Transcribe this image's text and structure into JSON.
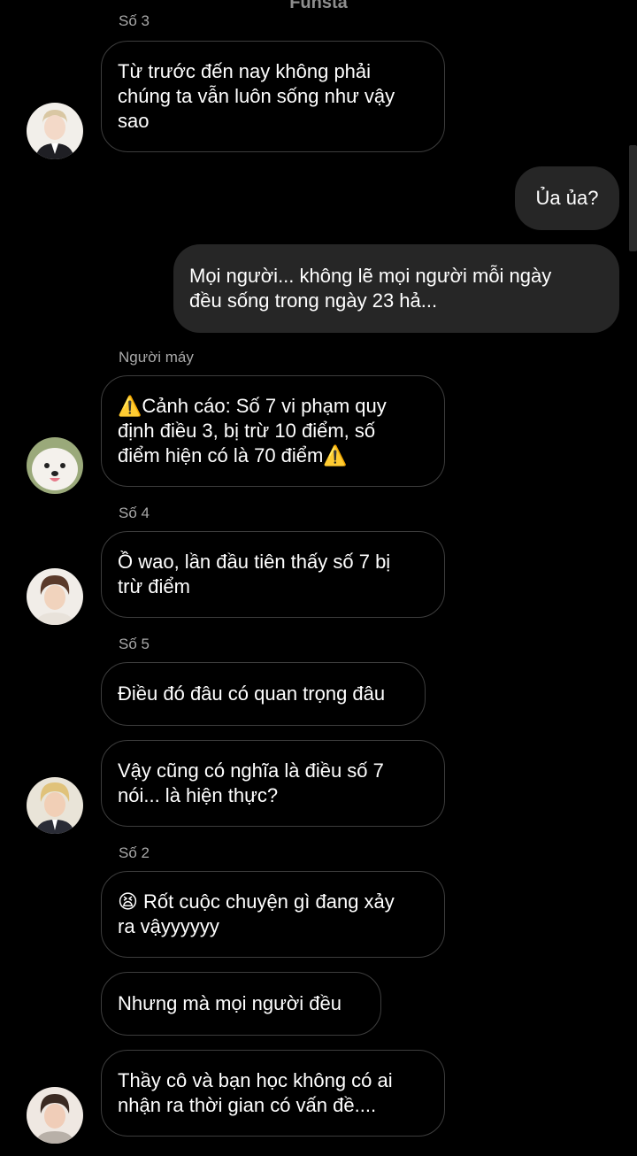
{
  "header": {
    "title": "Funsta"
  },
  "messages": {
    "m1_sender": "Số 3",
    "m1_line1": "Từ trước đến nay không phải",
    "m1_line2": "chúng ta vẫn luôn sống như vậy",
    "m1_line3": "sao",
    "m2_text": "Ủa ủa?",
    "m3_line1": "Mọi người... không lẽ mọi người mỗi ngày",
    "m3_line2": "đều sống trong ngày 23 hả...",
    "m4_sender": "Người máy",
    "m4_line1": "⚠️Cảnh cáo: Số 7 vi phạm quy",
    "m4_line2": "định điều 3, bị trừ 10 điểm, số",
    "m4_line3": "điểm hiện có là 70 điểm⚠️",
    "m5_sender": "Số 4",
    "m5_line1": "Ồ wao, lần đầu tiên thấy số 7 bị",
    "m5_line2": "trừ điểm",
    "m6_sender": "Số 5",
    "m6_text": "Điều đó đâu có quan trọng đâu",
    "m7_line1": "Vậy cũng có nghĩa là điều số 7",
    "m7_line2": "nói... là hiện thực?",
    "m8_sender": "Số 2",
    "m8_line1": "😫 Rốt cuộc chuyện gì đang xảy",
    "m8_line2": "ra vậyyyyyy",
    "m9_text": "Nhưng mà mọi người đều",
    "m10_line1": "Thầy cô và bạn học không có ai",
    "m10_line2": "nhận ra thời gian có vấn đề...."
  },
  "colors": {
    "background": "#000000",
    "incoming_border": "#3d3d3d",
    "outgoing_bg": "#262626",
    "sender_name": "#a8a8a8"
  },
  "icons": {
    "avatar_so3": "boy-avatar-icon",
    "avatar_robot": "dog-avatar-icon",
    "avatar_so4": "boy-avatar-icon",
    "avatar_so5": "boy-avatar-icon",
    "avatar_so2": "boy-avatar-icon"
  }
}
